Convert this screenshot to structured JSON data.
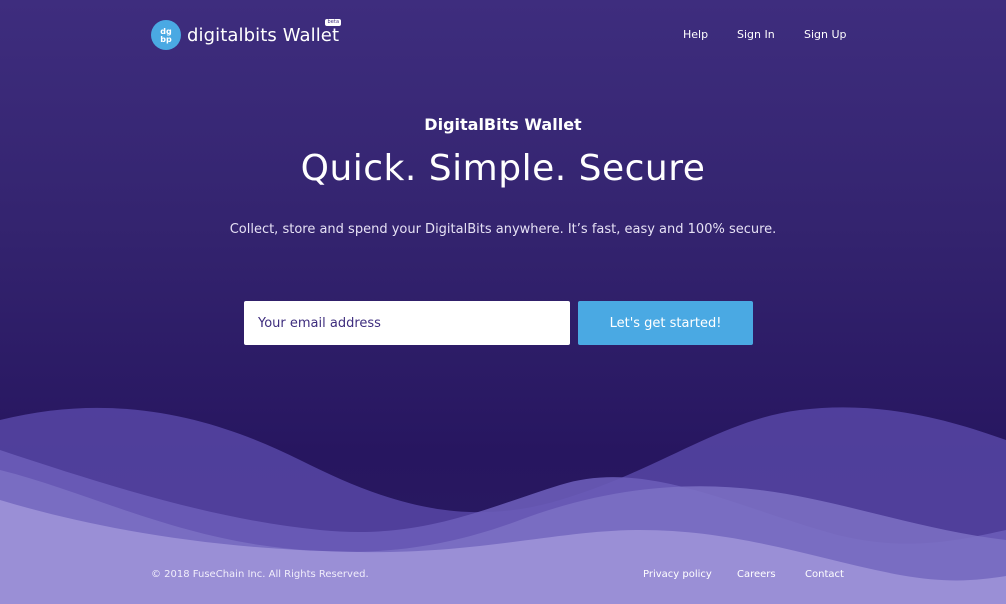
{
  "header": {
    "brand": "digitalbits Wallet",
    "badge": "beta",
    "nav": {
      "help": "Help",
      "sign_in": "Sign In",
      "sign_up": "Sign Up"
    }
  },
  "hero": {
    "kicker": "DigitalBits Wallet",
    "title": "Quick. Simple. Secure",
    "subtitle": "Collect, store and spend your DigitalBits anywhere. It’s fast, easy and 100% secure."
  },
  "signup_form": {
    "email_placeholder": "Your email address",
    "email_value": "",
    "cta_label": "Let's get started!"
  },
  "footer": {
    "copyright": "© 2018 FuseChain Inc. All Rights Reserved.",
    "links": {
      "privacy": "Privacy policy",
      "careers": "Careers",
      "contact": "Contact"
    }
  },
  "colors": {
    "background_top": "#3e2d7e",
    "background_bottom": "#271660",
    "accent": "#4aa9e3",
    "wave_light": "#9a8fd6",
    "wave_mid": "#6a5cb8",
    "wave_dark": "#5747a6"
  },
  "icons": {
    "logo": "digitalbits-logo-icon"
  }
}
